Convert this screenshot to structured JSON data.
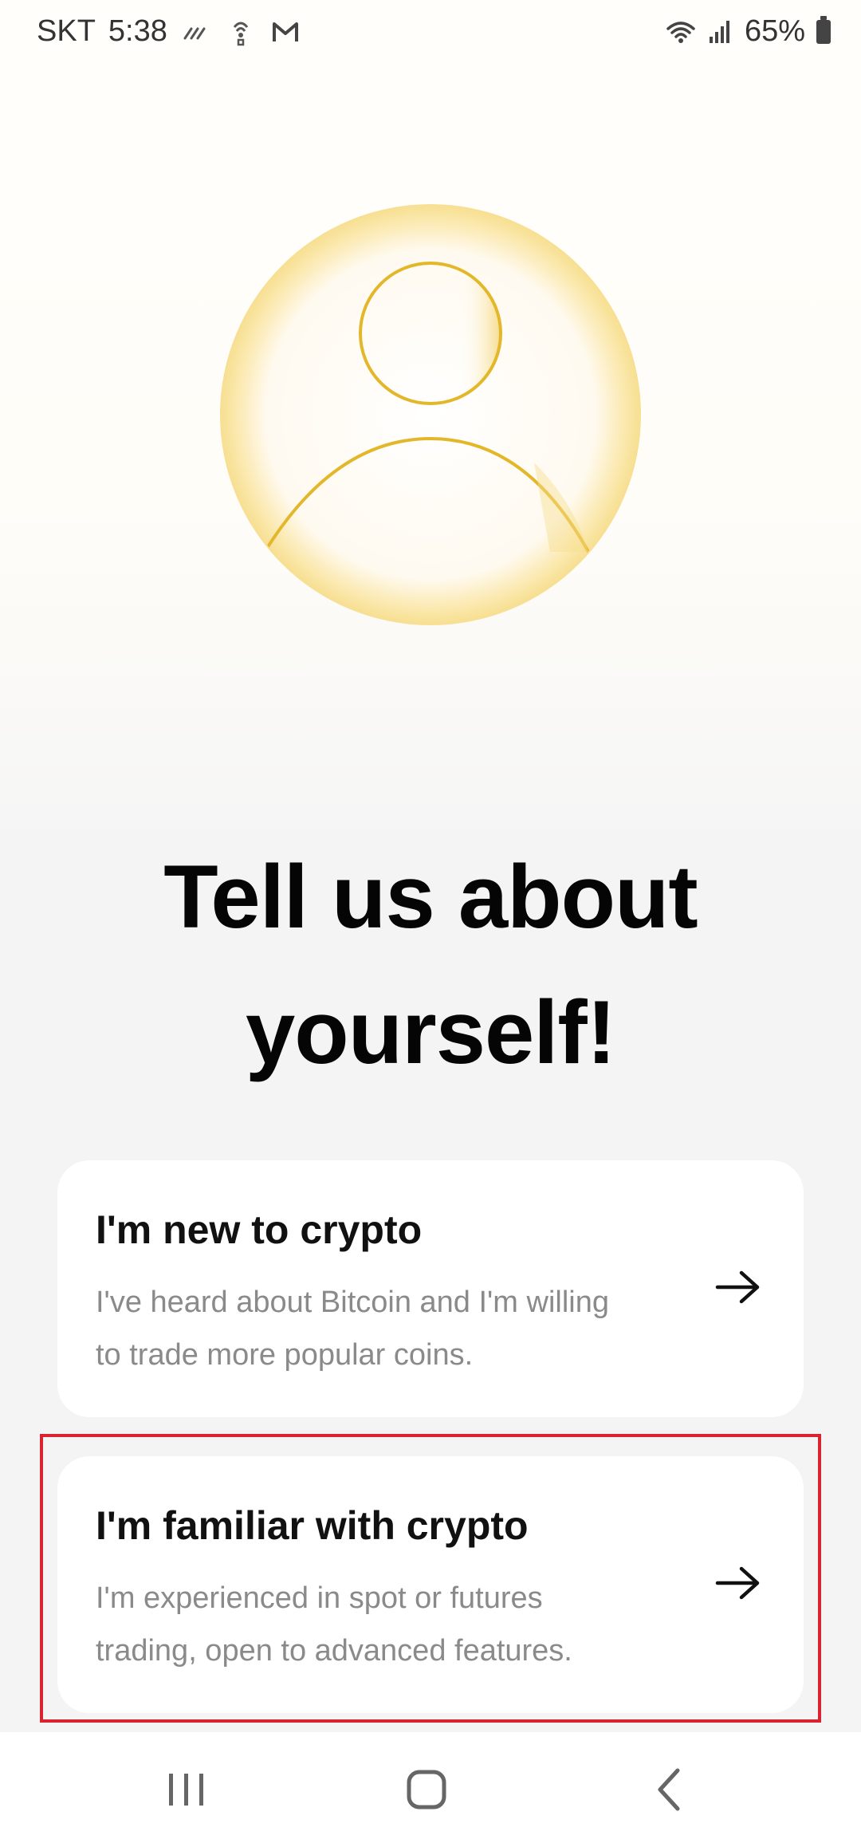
{
  "status_bar": {
    "carrier": "SKT",
    "time": "5:38",
    "battery_percent": "65%"
  },
  "screen": {
    "headline_line1": "Tell us about",
    "headline_line2": "yourself!"
  },
  "options": [
    {
      "title": "I'm new to crypto",
      "description_line1": "I've heard about Bitcoin and I'm willing",
      "description_line2": "to trade more popular coins."
    },
    {
      "title": "I'm familiar with crypto",
      "description_line1": "I'm experienced in spot or futures",
      "description_line2": "trading, open to advanced features."
    }
  ],
  "icons": {
    "avatar": "user-avatar-illustration",
    "arrow": "arrow-right-icon",
    "nav_recents": "recent-apps-icon",
    "nav_home": "home-icon",
    "nav_back": "back-icon"
  },
  "colors": {
    "accent_gold": "#e8bb2a",
    "highlight_red": "#d9232e",
    "card_bg": "#ffffff"
  }
}
